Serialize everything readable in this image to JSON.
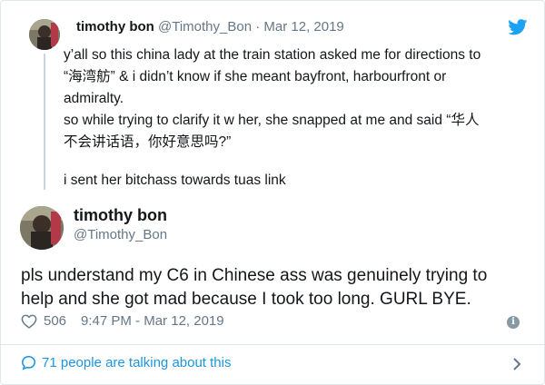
{
  "parent_tweet": {
    "name": "timothy bon",
    "handle": "@Timothy_Bon",
    "separator": "·",
    "date": "Mar 12, 2019",
    "lines": [
      "y’all so this china lady at the train station asked me for directions to",
      "“海湾舫” & i didn’t know if she meant bayfront, harbourfront or",
      "admiralty.",
      "so while trying to clarify it w her, she snapped at me and said “华人",
      "不会讲话语，你好意思吗?”"
    ],
    "last_line": "i sent her bitchass towards tuas link"
  },
  "main_tweet": {
    "name": "timothy bon",
    "handle": "@Timothy_Bon",
    "text_lines": [
      "pls understand my C6 in Chinese ass was genuinely trying to",
      "help and she got mad because I took too long. GURL BYE."
    ],
    "likes": "506",
    "timestamp": "9:47 PM - Mar 12, 2019"
  },
  "footer": {
    "talking": "71 people are talking about this"
  },
  "colors": {
    "brand": "#1da1f2",
    "link": "#1b95e0",
    "muted": "#657786",
    "text": "#14171a"
  },
  "icons": [
    "twitter-bird-icon",
    "heart-icon",
    "info-icon",
    "speech-bubble-icon",
    "chevron-right-icon"
  ]
}
